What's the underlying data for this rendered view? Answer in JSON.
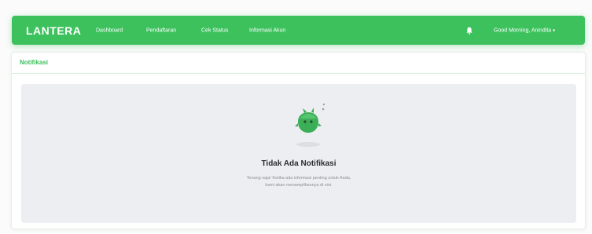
{
  "navbar": {
    "brand": "LANTERA",
    "links": [
      "Dashboard",
      "Pendaftaran",
      "Cek Status",
      "Informasi Akun"
    ],
    "bell_icon": "bell-icon",
    "user_greeting": "Good Morning, Anindita",
    "user_caret": "▾",
    "color": "#3cc15d"
  },
  "card": {
    "title": "Notifikasi",
    "empty_state": {
      "illustration": "green-mascot-icon",
      "title": "Tidak Ada Notifikasi",
      "desc_line1": "Tenang saja! Ketika ada informasi penting untuk Anda,",
      "desc_line2": "kami akan menampilkannya di sini."
    }
  }
}
